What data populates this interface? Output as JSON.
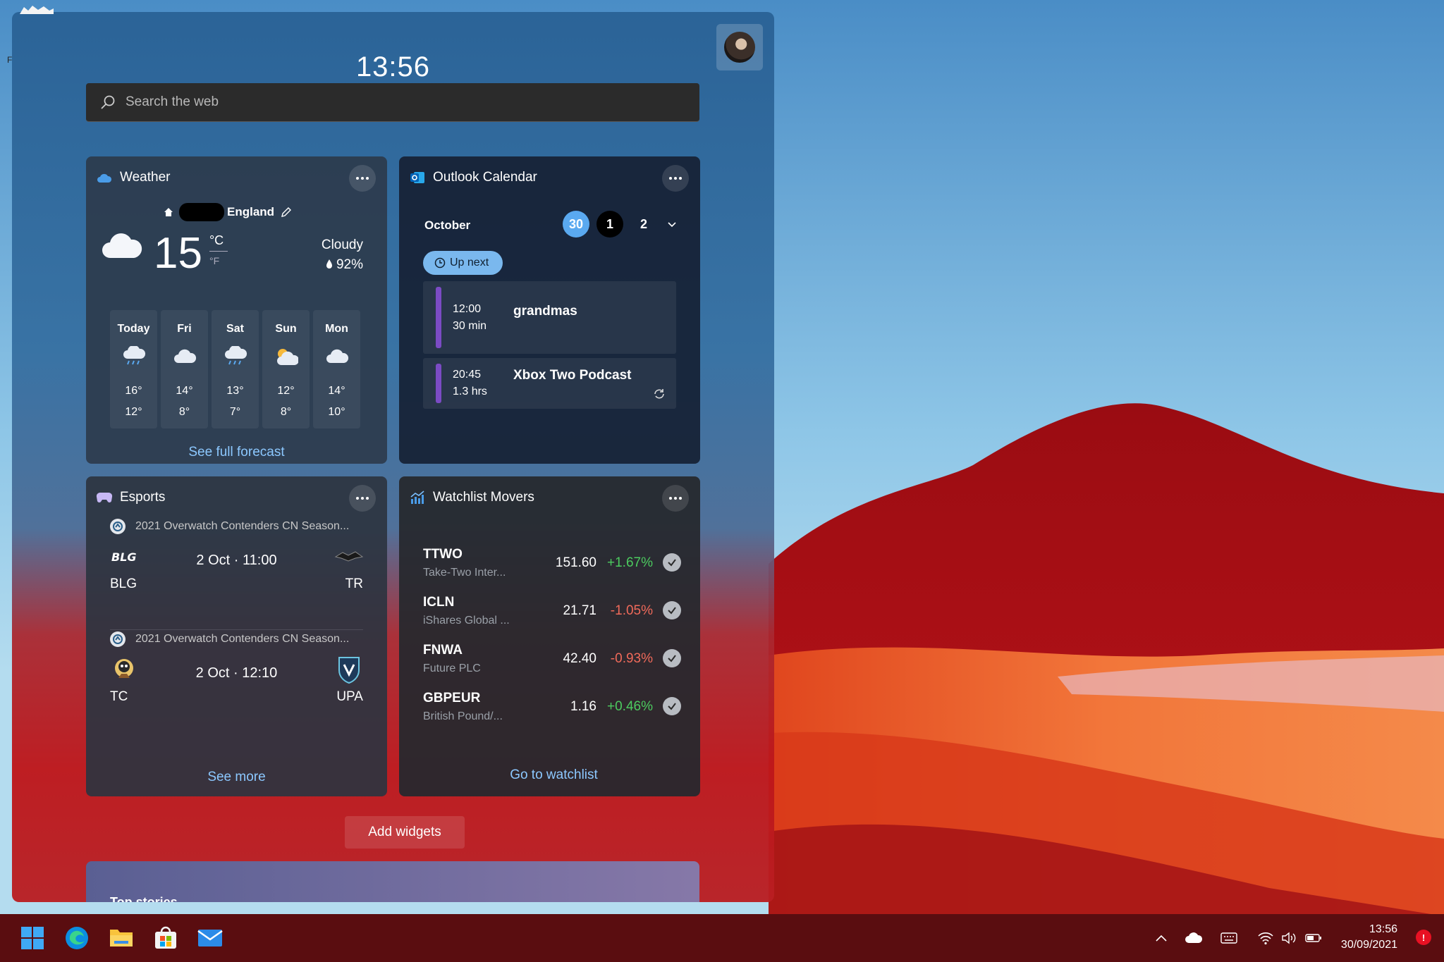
{
  "clock": "13:56",
  "search": {
    "placeholder": "Search the web"
  },
  "weather": {
    "title": "Weather",
    "location": "England",
    "temp": "15",
    "unit_c": "°C",
    "unit_f": "°F",
    "condition": "Cloudy",
    "humidity": "92%",
    "days": [
      {
        "day": "Today",
        "icon": "rain-cloud-icon",
        "hi": "16°",
        "lo": "12°"
      },
      {
        "day": "Fri",
        "icon": "cloud-icon",
        "hi": "14°",
        "lo": "8°"
      },
      {
        "day": "Sat",
        "icon": "rain-cloud-icon",
        "hi": "13°",
        "lo": "7°"
      },
      {
        "day": "Sun",
        "icon": "partly-sunny-icon",
        "hi": "12°",
        "lo": "8°"
      },
      {
        "day": "Mon",
        "icon": "cloud-icon",
        "hi": "14°",
        "lo": "10°"
      }
    ],
    "link": "See full forecast"
  },
  "calendar": {
    "title": "Outlook Calendar",
    "month": "October",
    "days": [
      "30",
      "1",
      "2"
    ],
    "up_next": "Up next",
    "events": [
      {
        "time": "12:00",
        "duration": "30 min",
        "title": "grandmas"
      },
      {
        "time": "20:45",
        "duration": "1.3 hrs",
        "title": "Xbox Two Podcast"
      }
    ]
  },
  "esports": {
    "title": "Esports",
    "matches": [
      {
        "league": "2021 Overwatch Contenders CN Season...",
        "date": "2 Oct",
        "time": "11:00",
        "team_left": "BLG",
        "team_right": "TR",
        "logo_left_text": "BLG"
      },
      {
        "league": "2021 Overwatch Contenders CN Season...",
        "date": "2 Oct",
        "time": "12:10",
        "team_left": "TC",
        "team_right": "UPA"
      }
    ],
    "link": "See more"
  },
  "watchlist": {
    "title": "Watchlist Movers",
    "stocks": [
      {
        "symbol": "TTWO",
        "name": "Take-Two Inter...",
        "price": "151.60",
        "change": "+1.67%",
        "dir": "up"
      },
      {
        "symbol": "ICLN",
        "name": "iShares Global ...",
        "price": "21.71",
        "change": "-1.05%",
        "dir": "down"
      },
      {
        "symbol": "FNWA",
        "name": "Future PLC",
        "price": "42.40",
        "change": "-0.93%",
        "dir": "down"
      },
      {
        "symbol": "GBPEUR",
        "name": "British Pound/...",
        "price": "1.16",
        "change": "+0.46%",
        "dir": "up"
      }
    ],
    "link": "Go to watchlist"
  },
  "add_widgets": "Add widgets",
  "top_stories": "Top stories",
  "corner_letter": "F",
  "taskbar": {
    "apps": [
      "windows-start-icon",
      "edge-icon",
      "file-explorer-icon",
      "microsoft-store-icon",
      "mail-icon"
    ],
    "time": "13:56",
    "date": "30/09/2021",
    "notifications": "!"
  },
  "colors": {
    "accent_blue": "#5aa9f0",
    "link": "#8cc8ff",
    "positive": "#4ccb5f",
    "negative": "#f06a5a",
    "event_bar": "#7b4bc4",
    "taskbar": "#5a0d10"
  }
}
